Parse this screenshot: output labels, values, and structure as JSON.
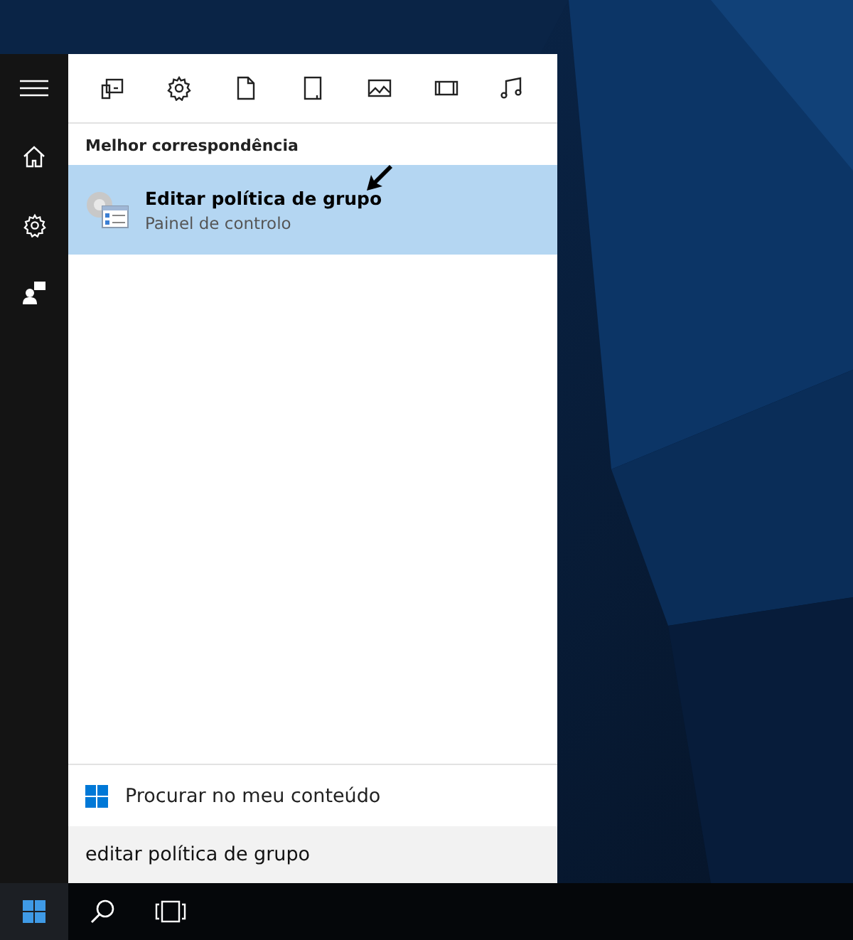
{
  "start_menu": {
    "filters": [
      {
        "kind": "apps"
      },
      {
        "kind": "settings"
      },
      {
        "kind": "documents"
      },
      {
        "kind": "folders"
      },
      {
        "kind": "photos"
      },
      {
        "kind": "videos"
      },
      {
        "kind": "music"
      }
    ],
    "section_title": "Melhor correspondência",
    "results": [
      {
        "title": "Editar política de grupo",
        "subtitle": "Painel de controlo",
        "selected": true
      }
    ],
    "search_my_content": "Procurar no meu conteúdo",
    "search": {
      "value": "editar política de grupo"
    }
  }
}
